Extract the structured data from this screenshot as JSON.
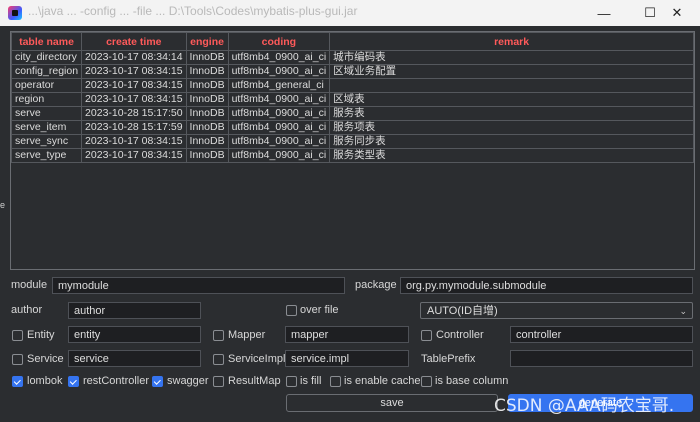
{
  "window": {
    "title": "...\\java ... -config ... -file ... D:\\Tools\\Codes\\mybatis-plus-gui.jar",
    "minimize": "—",
    "maximize": "☐",
    "close": "✕"
  },
  "left_strip": "e",
  "table": {
    "columns": [
      "table name",
      "create time",
      "engine",
      "coding",
      "remark"
    ],
    "rows": [
      [
        "city_directory",
        "2023-10-17 08:34:14",
        "InnoDB",
        "utf8mb4_0900_ai_ci",
        "城市编码表"
      ],
      [
        "config_region",
        "2023-10-17 08:34:15",
        "InnoDB",
        "utf8mb4_0900_ai_ci",
        "区域业务配置"
      ],
      [
        "operator",
        "2023-10-17 08:34:15",
        "InnoDB",
        "utf8mb4_general_ci",
        ""
      ],
      [
        "region",
        "2023-10-17 08:34:15",
        "InnoDB",
        "utf8mb4_0900_ai_ci",
        "区域表"
      ],
      [
        "serve",
        "2023-10-28 15:17:50",
        "InnoDB",
        "utf8mb4_0900_ai_ci",
        "服务表"
      ],
      [
        "serve_item",
        "2023-10-28 15:17:59",
        "InnoDB",
        "utf8mb4_0900_ai_ci",
        "服务项表"
      ],
      [
        "serve_sync",
        "2023-10-17 08:34:15",
        "InnoDB",
        "utf8mb4_0900_ai_ci",
        "服务同步表"
      ],
      [
        "serve_type",
        "2023-10-17 08:34:15",
        "InnoDB",
        "utf8mb4_0900_ai_ci",
        "服务类型表"
      ]
    ]
  },
  "form": {
    "module_label": "module",
    "module_value": "mymodule",
    "package_label": "package",
    "package_value": "org.py.mymodule.submodule",
    "author_label": "author",
    "author_value": "author",
    "overfile_label": "over file",
    "idtype_value": "AUTO(ID自增)",
    "entity_label": "Entity",
    "entity_value": "entity",
    "mapper_label": "Mapper",
    "mapper_value": "mapper",
    "controller_label": "Controller",
    "controller_value": "controller",
    "service_label": "Service",
    "service_value": "service",
    "serviceimpl_label": "ServiceImpl",
    "serviceimpl_value": "service.impl",
    "tableprefix_label": "TablePrefix",
    "tableprefix_value": "",
    "lombok_label": "lombok",
    "restcontroller_label": "restController",
    "swagger_label": "swagger",
    "resultmap_label": "ResultMap",
    "isfill_label": "is fill",
    "isenablecache_label": "is enable cache",
    "isbasecolumn_label": "is base column",
    "save_label": "save",
    "generate_label": "generate"
  },
  "checks": {
    "overfile": false,
    "entity": false,
    "mapper": false,
    "controller": false,
    "service": false,
    "serviceimpl": false,
    "lombok": true,
    "restcontroller": true,
    "swagger": true,
    "resultmap": false,
    "isfill": false,
    "isenablecache": false,
    "isbasecolumn": false
  },
  "watermark": "CSDN @AAA码农宝哥.",
  "colors": {
    "accent": "#3574f0",
    "header_text": "#ff5a5a",
    "background": "#2b2d30"
  }
}
